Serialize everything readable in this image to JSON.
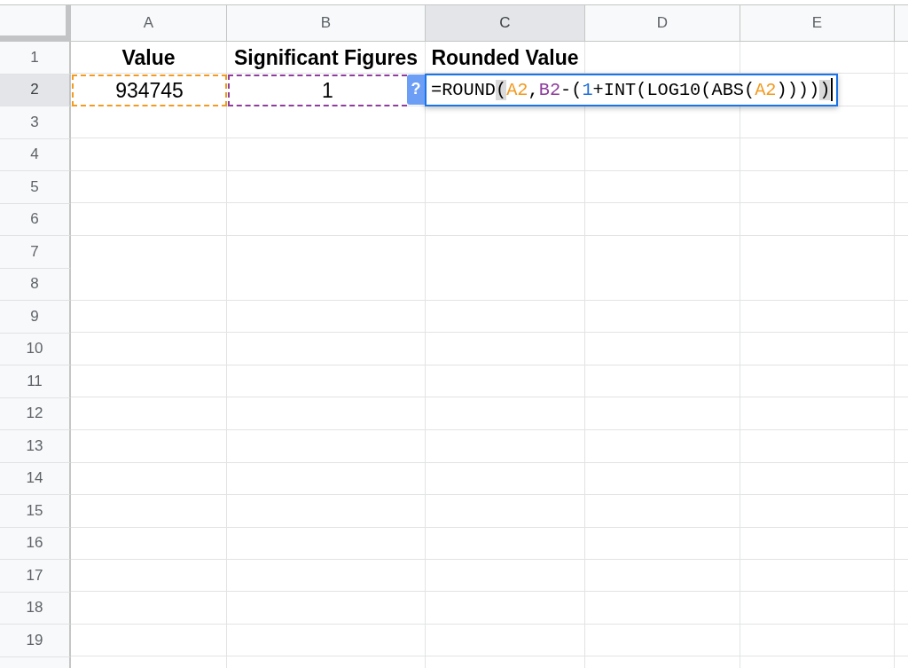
{
  "sheet": {
    "columns": [
      {
        "label": "A",
        "selected": false
      },
      {
        "label": "B",
        "selected": false
      },
      {
        "label": "C",
        "selected": true
      },
      {
        "label": "D",
        "selected": false
      },
      {
        "label": "E",
        "selected": false
      }
    ],
    "rows": [
      {
        "label": "1",
        "selected": false,
        "cells": [
          {
            "text": "Value",
            "bold": true
          },
          {
            "text": "Significant Figures",
            "bold": true
          },
          {
            "text": "Rounded Value",
            "bold": true
          }
        ]
      },
      {
        "label": "2",
        "selected": true,
        "cells": [
          {
            "text": "934745",
            "bold": false,
            "color": "#f29b22"
          },
          {
            "text": "1",
            "bold": false,
            "color": "#8e3d9e"
          }
        ]
      },
      {
        "label": "3",
        "selected": false
      },
      {
        "label": "4",
        "selected": false
      },
      {
        "label": "5",
        "selected": false
      },
      {
        "label": "6",
        "selected": false
      },
      {
        "label": "7",
        "selected": false
      },
      {
        "label": "8",
        "selected": false
      },
      {
        "label": "9",
        "selected": false
      },
      {
        "label": "10",
        "selected": false
      },
      {
        "label": "11",
        "selected": false
      },
      {
        "label": "12",
        "selected": false
      },
      {
        "label": "13",
        "selected": false
      },
      {
        "label": "14",
        "selected": false
      },
      {
        "label": "15",
        "selected": false
      },
      {
        "label": "16",
        "selected": false
      },
      {
        "label": "17",
        "selected": false
      },
      {
        "label": "18",
        "selected": false
      },
      {
        "label": "19",
        "selected": false
      }
    ]
  },
  "cell_editor": {
    "help_badge": "?",
    "tokens": [
      {
        "text": "=ROUND",
        "color": "#000000",
        "bracket_match": false
      },
      {
        "text": "(",
        "color": "#000000",
        "bracket_match": true
      },
      {
        "text": "A2",
        "color": "#f29b22",
        "bracket_match": false
      },
      {
        "text": ",",
        "color": "#000000",
        "bracket_match": false
      },
      {
        "text": "B2",
        "color": "#8e3d9e",
        "bracket_match": false
      },
      {
        "text": "-(",
        "color": "#000000",
        "bracket_match": false
      },
      {
        "text": "1",
        "color": "#1f6fdc",
        "bracket_match": false
      },
      {
        "text": "+INT(LOG10(ABS(",
        "color": "#000000",
        "bracket_match": false
      },
      {
        "text": "A2",
        "color": "#f29b22",
        "bracket_match": false
      },
      {
        "text": "))))",
        "color": "#000000",
        "bracket_match": false
      },
      {
        "text": ")",
        "color": "#000000",
        "bracket_match": true
      }
    ]
  }
}
